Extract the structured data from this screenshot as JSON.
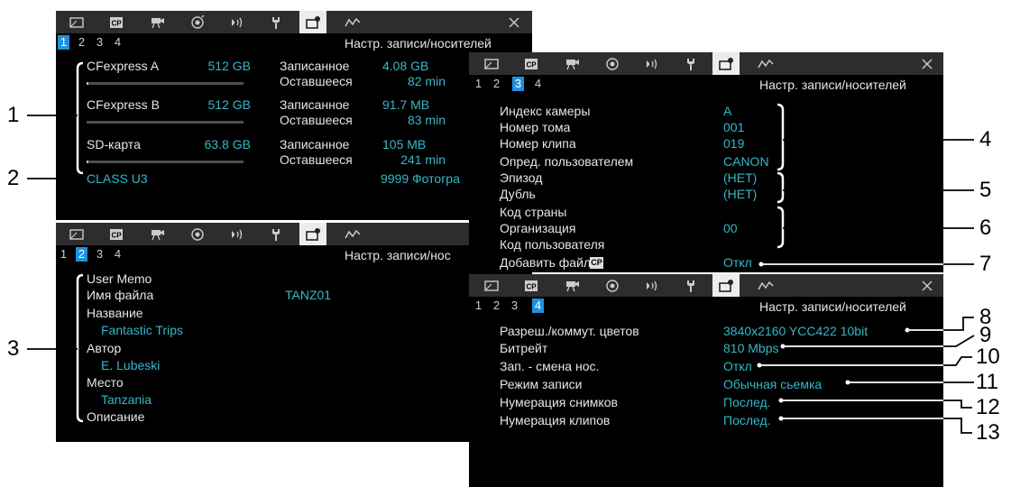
{
  "tabs_title": "Настр. записи/носителей",
  "icons": [
    "display-icon",
    "cp-icon",
    "camera-icon",
    "custom-picture-icon",
    "audio-icon",
    "wrench-icon",
    "recording-media-icon",
    "network-icon",
    "close-icon"
  ],
  "page1": {
    "pages": [
      "1",
      "2",
      "3",
      "4"
    ],
    "selected": 0,
    "media": [
      {
        "name": "CFexpress A",
        "size": "512 GB",
        "rec_label": "Записанное",
        "rec": "4.08 GB",
        "rem_label": "Оставшееся",
        "rem": "82 min",
        "used": 0.01
      },
      {
        "name": "CFexpress B",
        "size": "512 GB",
        "rec_label": "Записанное",
        "rec": "91.7 MB",
        "rem_label": "Оставшееся",
        "rem": "83 min",
        "used": 0.0
      },
      {
        "name": "SD-карта",
        "size": "63.8 GB",
        "rec_label": "Записанное",
        "rec": "105 MB",
        "rem_label": "Оставшееся",
        "rem": "241 min",
        "used": 0.01
      }
    ],
    "class": "CLASS U3",
    "photos": "9999 Фотогра"
  },
  "page2": {
    "pages": [
      "1",
      "2",
      "3",
      "4"
    ],
    "selected": 1,
    "title": "Настр. записи/нос",
    "user_memo": "User Memo",
    "file_name_label": "Имя файла",
    "file_name": "TANZ01",
    "title_label": "Название",
    "title_value": "Fantastic Trips",
    "author_label": "Автор",
    "author_value": "E. Lubeski",
    "place_label": "Место",
    "place_value": "Tanzania",
    "desc_label": "Описание"
  },
  "page3": {
    "pages": [
      "1",
      "2",
      "3",
      "4"
    ],
    "selected": 2,
    "rows": [
      {
        "label": "Индекс камеры",
        "value": "A"
      },
      {
        "label": "Номер тома",
        "value": "001"
      },
      {
        "label": "Номер клипа",
        "value": "019"
      },
      {
        "label": "Опред. пользователем",
        "value": "CANON"
      },
      {
        "label": "Эпизод",
        "value": "(НЕТ)"
      },
      {
        "label": "Дубль",
        "value": "(НЕТ)"
      },
      {
        "label": "Код страны",
        "value": ""
      },
      {
        "label": "Организация",
        "value": "00"
      },
      {
        "label": "Код пользователя",
        "value": ""
      },
      {
        "label": "Добавить файл",
        "value": "Откл"
      }
    ],
    "cp_badge": "CP"
  },
  "page4": {
    "pages": [
      "1",
      "2",
      "3",
      "4"
    ],
    "selected": 3,
    "rows": [
      {
        "label": "Разреш./коммут. цветов",
        "value": "3840x2160 YCC422 10bit"
      },
      {
        "label": "Битрейт",
        "value": "810 Mbps"
      },
      {
        "label": "Зап. - смена нос.",
        "value": "Откл"
      },
      {
        "label": "Режим записи",
        "value": "Обычная сьемка"
      },
      {
        "label": "Нумерация снимков",
        "value": "Послед."
      },
      {
        "label": "Нумерация клипов",
        "value": "Послед."
      }
    ]
  },
  "callouts": [
    "1",
    "2",
    "3",
    "4",
    "5",
    "6",
    "7",
    "8",
    "9",
    "10",
    "11",
    "12",
    "13"
  ],
  "colors": {
    "value": "#34b8c8",
    "selected_page": "#1e90e0",
    "iconbar": "#2d2d2d"
  }
}
